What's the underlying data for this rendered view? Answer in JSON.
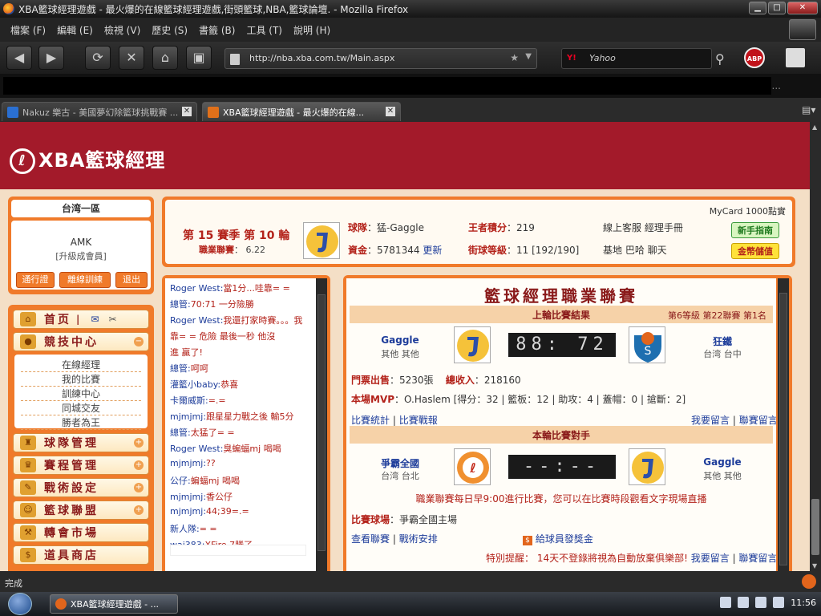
{
  "window": {
    "title": "XBA籃球經理遊戲 - 最火爆的在線籃球經理遊戲,街頭籃球,NBA,籃球論壇. - Mozilla Firefox"
  },
  "menu": [
    "檔案 (F)",
    "編輯 (E)",
    "檢視 (V)",
    "歷史 (S)",
    "書籤 (B)",
    "工具 (T)",
    "說明 (H)"
  ],
  "nav": {
    "url": "http://nba.xba.com.tw/Main.aspx",
    "search_placeholder": "Yahoo",
    "search_engine": "Y!",
    "abp": "ABP",
    "bookmarks_more": "..."
  },
  "tabs": [
    {
      "label": "Nakuz 樂古 - 美國夢幻除籃球挑戰賽 ...",
      "active": false
    },
    {
      "label": "XBA籃球經理遊戲 - 最火爆的在線...",
      "active": true
    }
  ],
  "site": {
    "logo_text": "XBA籃球經理"
  },
  "user": {
    "server": "台湾一區",
    "name": "AMK",
    "rank": "[升級成會員]",
    "buttons": [
      "通行證",
      "離線訓練",
      "退出"
    ]
  },
  "sidebar": {
    "top": {
      "home": "首页",
      "separator": "|",
      "mail_icon": "mail-icon",
      "tools_icon": "tools-icon"
    },
    "items": [
      {
        "label": "競技中心",
        "toggle": "−"
      },
      {
        "label": "球隊管理",
        "toggle": "+"
      },
      {
        "label": "賽程管理",
        "toggle": "+"
      },
      {
        "label": "戰術設定",
        "toggle": "+"
      },
      {
        "label": "籃球聯盟",
        "toggle": "+"
      },
      {
        "label": "轉會市場",
        "toggle": "+"
      },
      {
        "label": "道具商店",
        "toggle": ""
      }
    ],
    "submenu": [
      "在線經理",
      "我的比賽",
      "訓練中心",
      "同城交友",
      "勝者為王"
    ]
  },
  "info": {
    "mycard": "MyCard 1000點實",
    "season": "第 15 賽季 第 10 輪",
    "league_label": "職業聯賽",
    "league_value": "6.22",
    "team_label": "球隊",
    "team_value": "猛-Gaggle",
    "funds_label": "資金",
    "funds_value": "5781344",
    "funds_update": "更新",
    "king_label": "王者積分",
    "king_value": "219",
    "street_label": "街球等級",
    "street_value": "11 [192/190]",
    "links_row1": "線上客服 經理手冊",
    "links_row2": "基地 巴哈 聊天",
    "guide_button": "新手指南",
    "gold_button": "金幣儲值"
  },
  "chat": {
    "lines": [
      {
        "user": "Roger West",
        "msg": "當1分...哇靠= ="
      },
      {
        "user": "總管",
        "msg": "70:71 一分險勝"
      },
      {
        "user": "Roger West",
        "msg": "我還打家時賽。。。我"
      },
      {
        "user": "",
        "msg": "靠=  =  危險  最後一秒  他沒"
      },
      {
        "user": "",
        "msg": "進  贏了!"
      },
      {
        "user": "總管",
        "msg": "呵呵"
      },
      {
        "user": "灌籃小baby",
        "msg": "恭喜"
      },
      {
        "user": "卡爾威斯",
        "msg": "=.="
      },
      {
        "user": "mjmjmj",
        "msg": "跟星星力戰之後 輸5分"
      },
      {
        "user": "總管",
        "msg": "太猛了= ="
      },
      {
        "user": "Roger West",
        "msg": "臭蝙蝠mj 喝喝"
      },
      {
        "user": "mjmjmj",
        "msg": "??"
      },
      {
        "user": "公仔",
        "msg": "蝙蝠mj 喝喝"
      },
      {
        "user": "mjmjmj",
        "msg": "香公仔"
      },
      {
        "user": "mjmjmj",
        "msg": "44;39=.="
      },
      {
        "user": "新人隊",
        "msg": "= ="
      },
      {
        "user": "wai383",
        "msg": "XFire 7勝了"
      }
    ]
  },
  "main": {
    "title": "籃球經理職業聯賽",
    "last": {
      "header": "上輪比賽結果",
      "rank_info": "第6等級 第22聯賽 第1名",
      "home_name": "Gaggle",
      "home_loc": "其他 其他",
      "score": "88: 72",
      "away_name": "狂鐵",
      "away_loc": "台湾 台中",
      "tickets_label": "門票出售",
      "tickets_value": "5230張",
      "income_label": "總收入",
      "income_value": "218160",
      "mvp_label": "本場MVP",
      "mvp_value": "O.Haslem [得分：32 | 籃板：12 | 助攻：4 | 蓋帽：0 | 搶斷：2]",
      "link_stats": "比賽統計",
      "link_report": "比賽戰報",
      "link_comment": "我要留言",
      "link_league_comment": "聯賽留言"
    },
    "next": {
      "header": "本輪比賽對手",
      "home_name": "爭霸全國",
      "home_loc": "台湾 台北",
      "score": "--:--",
      "away_name": "Gaggle",
      "away_loc": "其他 其他",
      "notice": "職業聯賽每日早9:00進行比賽，您可以在比賽時段觀看文字現場直播",
      "venue_label": "比賽球場",
      "venue_value": "爭霸全國主場",
      "link_view": "查看聯賽",
      "link_tactics": "戰術安排",
      "link_bonus": "給球員發獎金",
      "reminder": "特別提醒： 14天不登錄將視為自動放棄俱樂部!",
      "link_comment": "我要留言",
      "link_league_comment": "聯賽留言"
    }
  },
  "status": {
    "text": "完成"
  },
  "taskbar": {
    "item": "XBA籃球經理遊戲 - ...",
    "clock": "11:56"
  }
}
